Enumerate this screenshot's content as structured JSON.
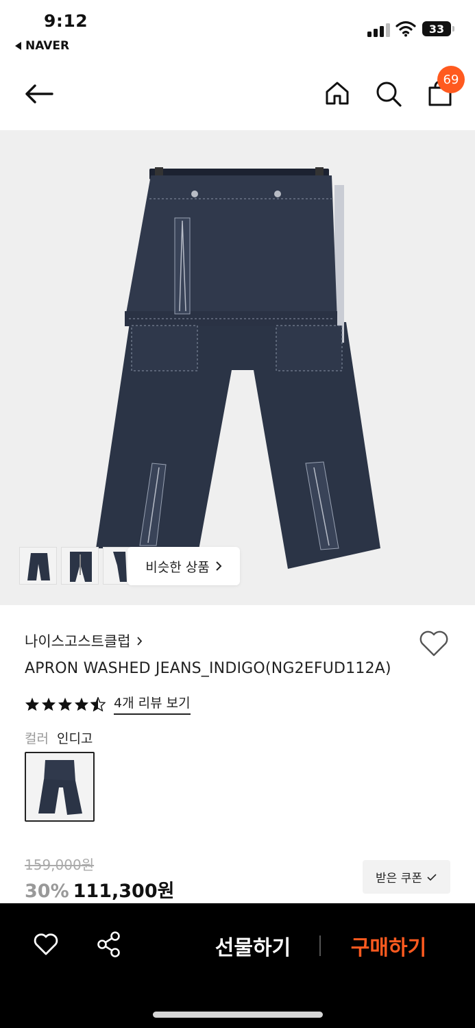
{
  "status_bar": {
    "time": "9:12",
    "back_app": "NAVER",
    "battery": "33"
  },
  "header": {
    "cart_count": "69",
    "icons": [
      "back-arrow-icon",
      "home-icon",
      "search-icon",
      "shopping-bag-icon"
    ]
  },
  "gallery": {
    "similar_label": "비슷한 상품"
  },
  "product": {
    "brand": "나이스고스트클럽",
    "title": "APRON WASHED JEANS_INDIGO(NG2EFUD112A)",
    "rating": 4.5,
    "review_link": "4개 리뷰 보기",
    "color_label": "컬러",
    "color_value": "인디고",
    "original_price": "159,000원",
    "discount": "30%",
    "price": "111,300원",
    "coupon_label": "받은 쿠폰"
  },
  "bottom_bar": {
    "gift_label": "선물하기",
    "buy_label": "구매하기"
  },
  "colors": {
    "accent": "#ff5a1f",
    "denim": "#2b3446"
  }
}
